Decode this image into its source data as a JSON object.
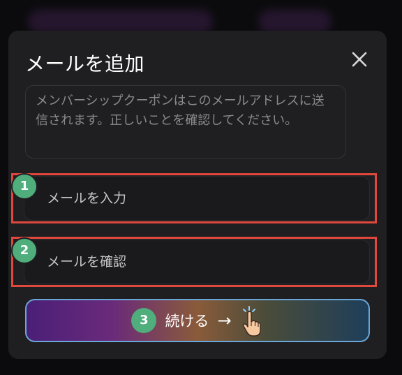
{
  "modal": {
    "title": "メールを追加",
    "close_icon": "close-icon",
    "info_text": "メンバーシップクーポンはこのメールアドレスに送信されます。正しいことを確認してください。"
  },
  "fields": {
    "email": {
      "placeholder": "メールを入力",
      "value": "",
      "step": "1"
    },
    "confirm": {
      "placeholder": "メールを確認",
      "value": "",
      "step": "2"
    }
  },
  "continue_button": {
    "label": "続ける",
    "arrow": "→",
    "step": "3",
    "icon": "pointing-hand-icon"
  },
  "colors": {
    "highlight": "#e0473d",
    "step_badge": "#4fae7c",
    "modal_bg": "#1f1f21",
    "button_border": "#6aa7d8"
  }
}
